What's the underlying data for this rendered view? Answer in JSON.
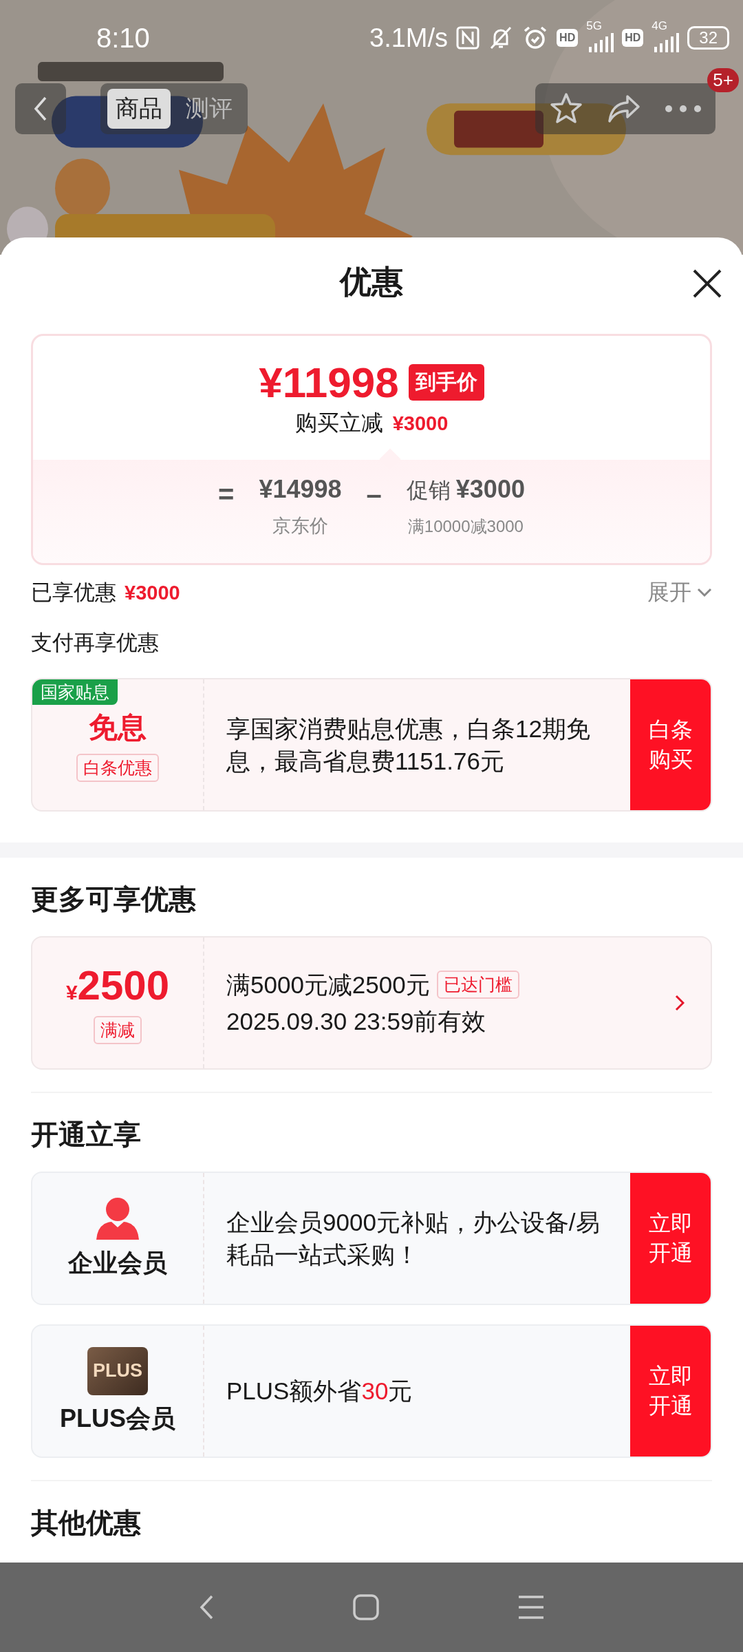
{
  "status_bar": {
    "time": "8:10",
    "speed": "3.1M/s",
    "sim_1": {
      "hd": "HD",
      "network": "5G"
    },
    "sim_2": {
      "hd": "HD",
      "network": "4G"
    },
    "battery": "32"
  },
  "top_nav": {
    "tabs": [
      {
        "label": "商品",
        "selected": true
      },
      {
        "label": "测评",
        "selected": false
      }
    ],
    "badge": "5+"
  },
  "sheet": {
    "title": "优惠",
    "price_card": {
      "final_price": "¥11998",
      "price_tag": "到手价",
      "saving_label": "购买立减",
      "saving_amount": "¥3000",
      "equals": "=",
      "jd_price": "¥14998",
      "jd_price_label": "京东价",
      "minus": "–",
      "promo_label": "促销",
      "promo_amount": "¥3000",
      "promo_rule": "满10000减3000"
    },
    "enjoyed": {
      "label": "已享优惠",
      "amount": "¥3000",
      "toggle": "展开",
      "expanded": false
    },
    "pay_offers": {
      "title": "支付再享优惠",
      "items": [
        {
          "tag": "国家贴息",
          "title": "免息",
          "subtitle": "白条优惠",
          "description": "享国家消费贴息优惠，白条12期免息，最高省息费1151.76元",
          "action": "白条购买"
        }
      ]
    },
    "more_offers": {
      "title": "更多可享优惠",
      "items": [
        {
          "currency": "¥",
          "amount": "2500",
          "type_label": "满减",
          "rule": "满5000元减2500元",
          "status": "已达门槛",
          "validity": "2025.09.30 23:59前有效"
        }
      ]
    },
    "membership": {
      "title": "开通立享",
      "items": [
        {
          "kind": "person",
          "name": "企业会员",
          "description": "企业会员9000元补贴，办公设备/易耗品一站式采购！",
          "action": "立即开通"
        },
        {
          "kind": "plus",
          "icon_label": "PLUS",
          "name": "PLUS会员",
          "description": "PLUS额外省",
          "highlight": "30",
          "suffix": "元",
          "action": "立即开通"
        }
      ]
    },
    "other_offers": {
      "title": "其他优惠"
    }
  }
}
